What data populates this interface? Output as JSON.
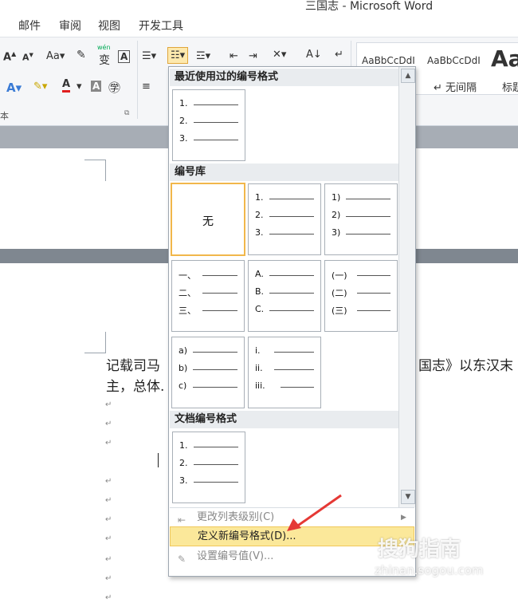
{
  "window": {
    "title": "三国志 - Microsoft Word"
  },
  "tabs": [
    "邮件",
    "审阅",
    "视图",
    "开发工具"
  ],
  "ribbon": {
    "font_group_label": "本",
    "style_samples": [
      "AaBbCcDdI",
      "AaBbCcDdI",
      "Aa"
    ],
    "style_names": [
      "↵ 无间隔",
      "标题"
    ],
    "wen_label": "wén"
  },
  "dropdown": {
    "recent_header": "最近使用过的编号格式",
    "library_header": "编号库",
    "doc_header": "文档编号格式",
    "none_label": "无",
    "recent": [
      [
        "1.",
        "2.",
        "3."
      ]
    ],
    "library": [
      [
        "1.",
        "2.",
        "3."
      ],
      [
        "1)",
        "2)",
        "3)"
      ],
      [
        "一、",
        "二、",
        "三、"
      ],
      [
        "A.",
        "B.",
        "C."
      ],
      [
        "(一)",
        "(二)",
        "(三)"
      ],
      [
        "a)",
        "b)",
        "c)"
      ],
      [
        "i.",
        "ii.",
        "iii."
      ]
    ],
    "doc": [
      [
        "1.",
        "2.",
        "3."
      ]
    ],
    "menu": {
      "change_level": "更改列表级别(C)",
      "define_new": "定义新编号格式(D)...",
      "set_value": "设置编号值(V)..."
    }
  },
  "document": {
    "line1_left": "记载司马",
    "line1_right": "国志》以东汉末",
    "line2": "主，总体."
  },
  "watermark": {
    "brand": "搜狗指南",
    "url": "zhinan.sogou.com"
  },
  "colors": {
    "highlight": "#fbe89a",
    "selected_border": "#f1b74b",
    "arrow": "#e53935"
  }
}
